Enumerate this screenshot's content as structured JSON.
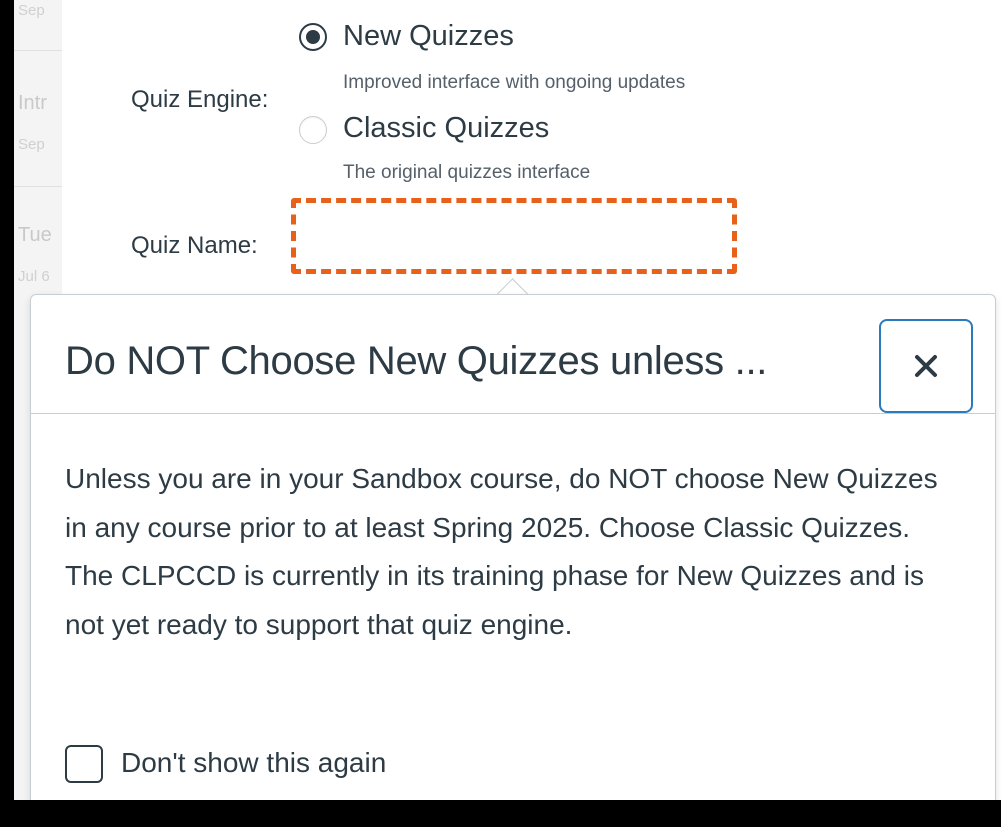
{
  "background_list": {
    "items": [
      {
        "title": "",
        "sub": "Sep"
      },
      {
        "title": "Intr",
        "sub": "Sep"
      },
      {
        "title": "Tue",
        "sub": "Jul 6"
      }
    ]
  },
  "form": {
    "quiz_engine_label": "Quiz Engine:",
    "options": [
      {
        "title": "New Quizzes",
        "description": "Improved interface with ongoing updates",
        "selected": true
      },
      {
        "title": "Classic Quizzes",
        "description": "The original quizzes interface",
        "selected": false
      }
    ],
    "quiz_name_label": "Quiz Name:",
    "quiz_name_value": "",
    "highlight_color": "#e8611b"
  },
  "popover": {
    "title": "Do NOT Choose New Quizzes unless ...",
    "close_icon": "close-icon",
    "body": "Unless you are in your Sandbox course, do NOT choose New Quizzes in any course prior to at least Spring 2025. Choose Classic Quizzes. The CLPCCD is currently in its training phase for New Quizzes and is not yet ready to support that quiz engine.",
    "checkbox_label": "Don't show this again",
    "checkbox_checked": false,
    "accent_color": "#2b7abc"
  }
}
